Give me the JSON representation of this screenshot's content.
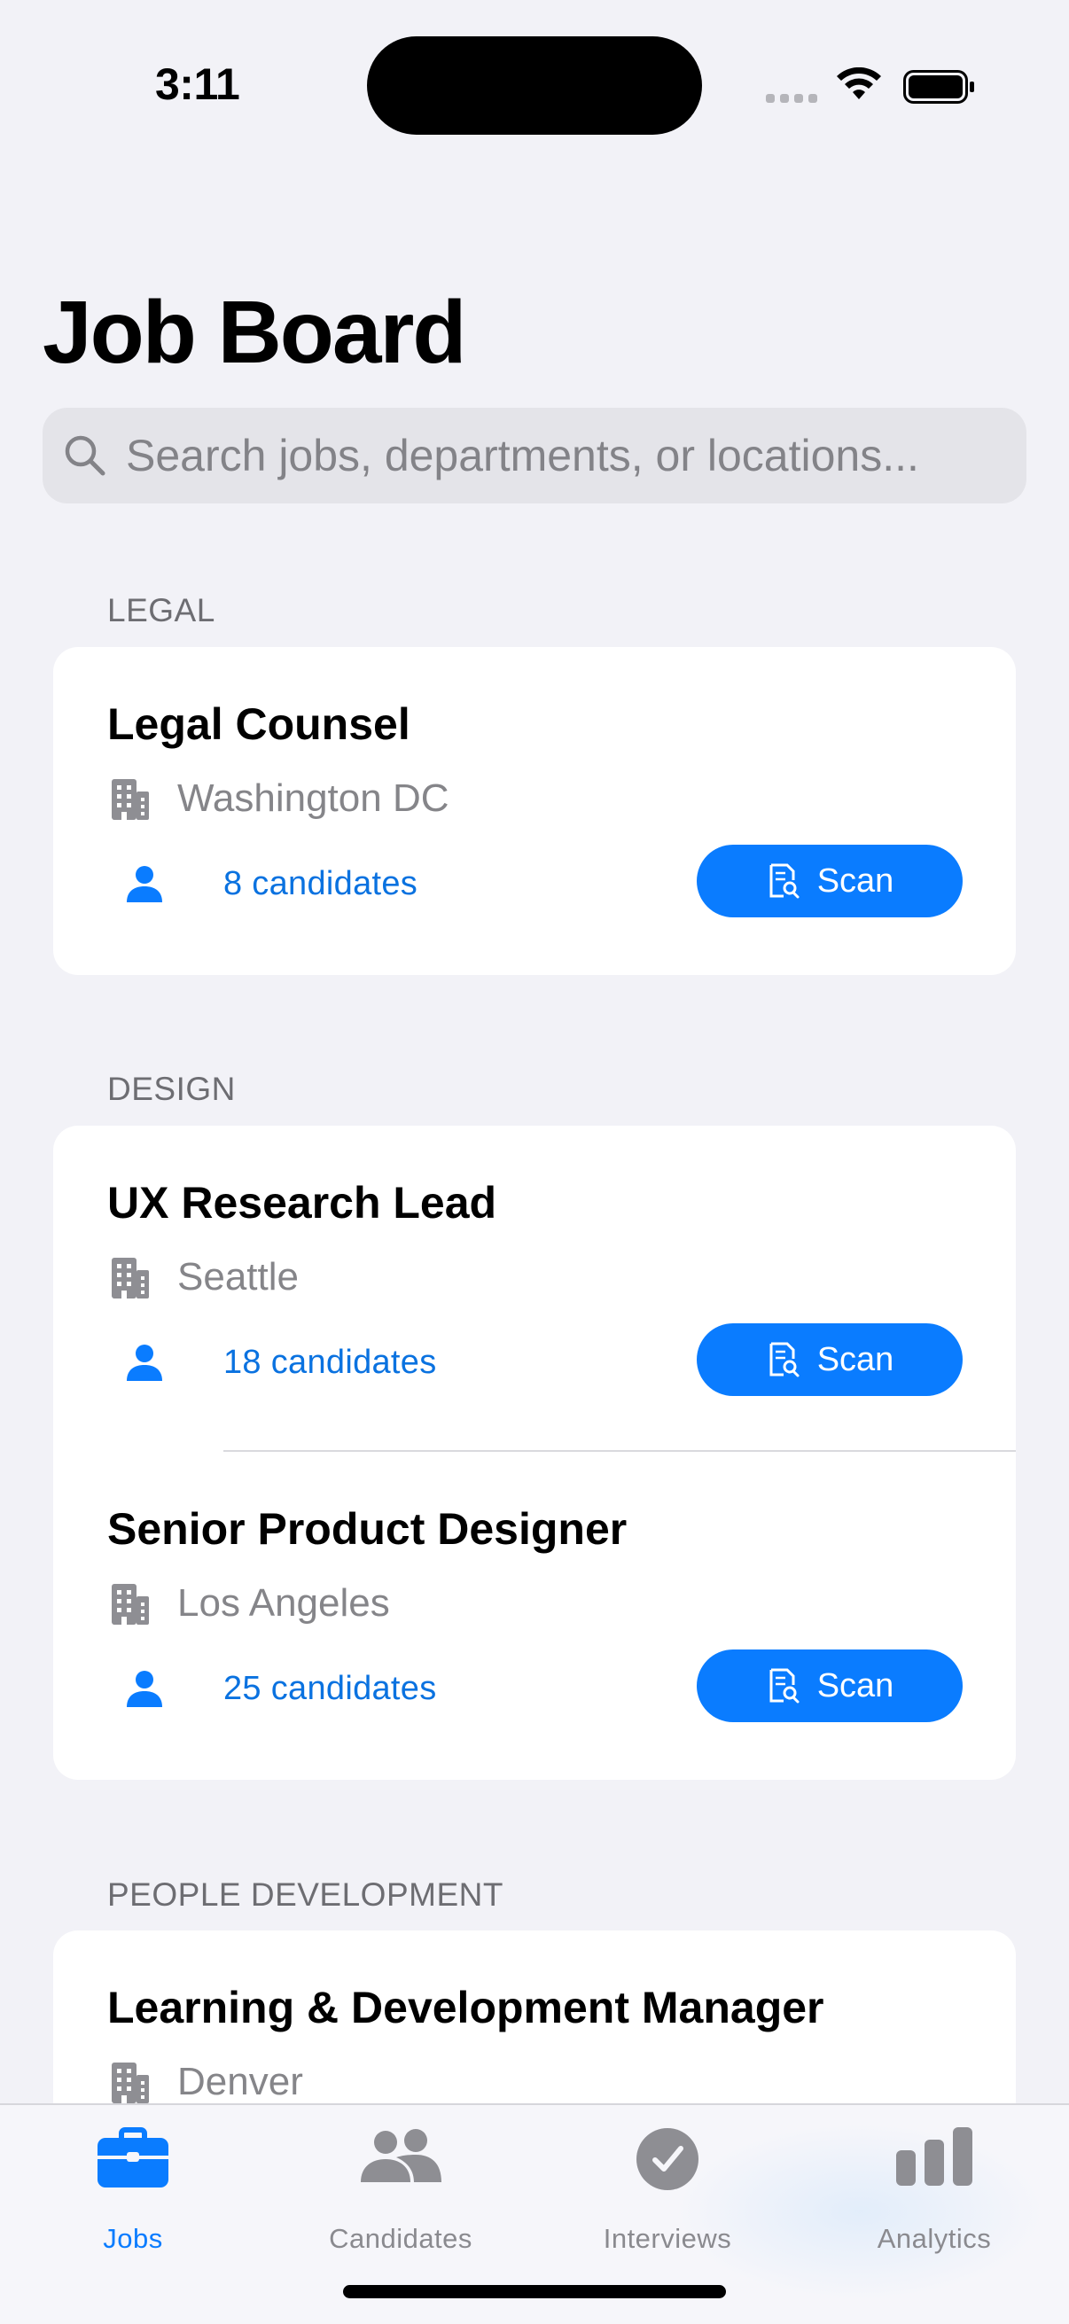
{
  "status_bar": {
    "time": "3:11"
  },
  "header": {
    "title": "Job Board"
  },
  "search": {
    "placeholder": "Search jobs, departments, or locations..."
  },
  "sections": [
    {
      "header": "LEGAL",
      "jobs": [
        {
          "title": "Legal Counsel",
          "location": "Washington DC",
          "candidates": "8 candidates",
          "action": "Scan"
        }
      ]
    },
    {
      "header": "DESIGN",
      "jobs": [
        {
          "title": "UX Research Lead",
          "location": "Seattle",
          "candidates": "18 candidates",
          "action": "Scan"
        },
        {
          "title": "Senior Product Designer",
          "location": "Los Angeles",
          "candidates": "25 candidates",
          "action": "Scan"
        }
      ]
    },
    {
      "header": "PEOPLE DEVELOPMENT",
      "jobs": [
        {
          "title": "Learning & Development Manager",
          "location": "Denver"
        }
      ]
    }
  ],
  "tab_bar": {
    "tabs": [
      {
        "label": "Jobs",
        "icon": "briefcase-icon",
        "active": true
      },
      {
        "label": "Candidates",
        "icon": "people-icon",
        "active": false
      },
      {
        "label": "Interviews",
        "icon": "checkmark-circle-icon",
        "active": false
      },
      {
        "label": "Analytics",
        "icon": "bar-chart-icon",
        "active": false
      }
    ]
  },
  "colors": {
    "accent": "#0a7cff",
    "background": "#f2f2f7",
    "secondary_text": "#858589",
    "candidates_text": "#0a72e0"
  }
}
